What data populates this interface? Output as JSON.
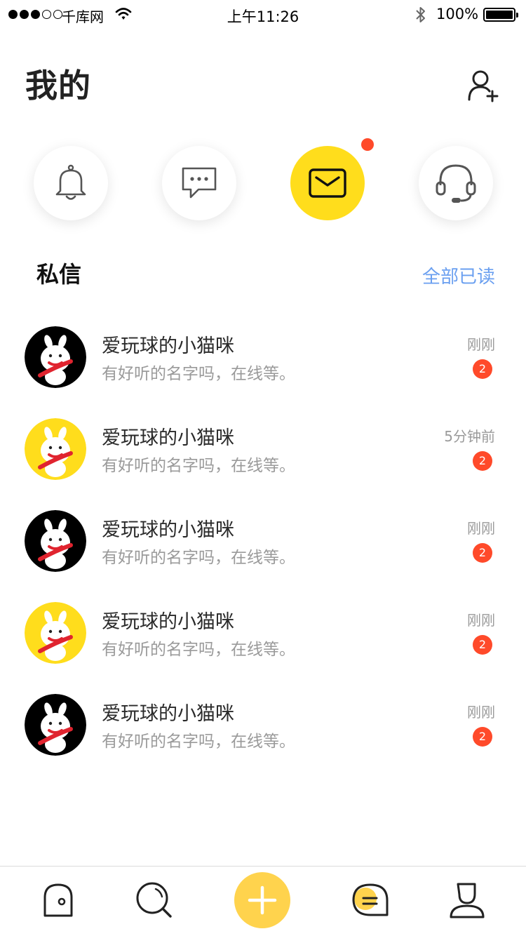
{
  "status_bar": {
    "carrier": "千库网",
    "time": "上午11:26",
    "battery": "100%"
  },
  "header": {
    "title": "我的"
  },
  "quick_actions": [
    {
      "icon": "bell-icon",
      "active": false
    },
    {
      "icon": "comment-icon",
      "active": false
    },
    {
      "icon": "mail-icon",
      "active": true,
      "has_dot": true
    },
    {
      "icon": "headset-icon",
      "active": false
    }
  ],
  "section": {
    "title": "私信",
    "mark_all_read": "全部已读"
  },
  "messages": [
    {
      "name": "爱玩球的小猫咪",
      "preview": "有好听的名字吗，在线等。",
      "time": "刚刚",
      "unread": "2",
      "avatar_bg": "#000000"
    },
    {
      "name": "爱玩球的小猫咪",
      "preview": "有好听的名字吗，在线等。",
      "time": "5分钟前",
      "unread": "2",
      "avatar_bg": "#ffdd1c"
    },
    {
      "name": "爱玩球的小猫咪",
      "preview": "有好听的名字吗，在线等。",
      "time": "刚刚",
      "unread": "2",
      "avatar_bg": "#000000"
    },
    {
      "name": "爱玩球的小猫咪",
      "preview": "有好听的名字吗，在线等。",
      "time": "刚刚",
      "unread": "2",
      "avatar_bg": "#ffdd1c"
    },
    {
      "name": "爱玩球的小猫咪",
      "preview": "有好听的名字吗，在线等。",
      "time": "刚刚",
      "unread": "2",
      "avatar_bg": "#000000"
    }
  ],
  "tab_bar": [
    {
      "icon": "home-icon"
    },
    {
      "icon": "search-icon"
    },
    {
      "icon": "plus-icon"
    },
    {
      "icon": "message-icon",
      "active": true
    },
    {
      "icon": "profile-icon"
    }
  ],
  "colors": {
    "accent": "#ffdd1c",
    "badge": "#ff4a2a",
    "link": "#6a9ff0",
    "plus": "#ffd34d"
  }
}
